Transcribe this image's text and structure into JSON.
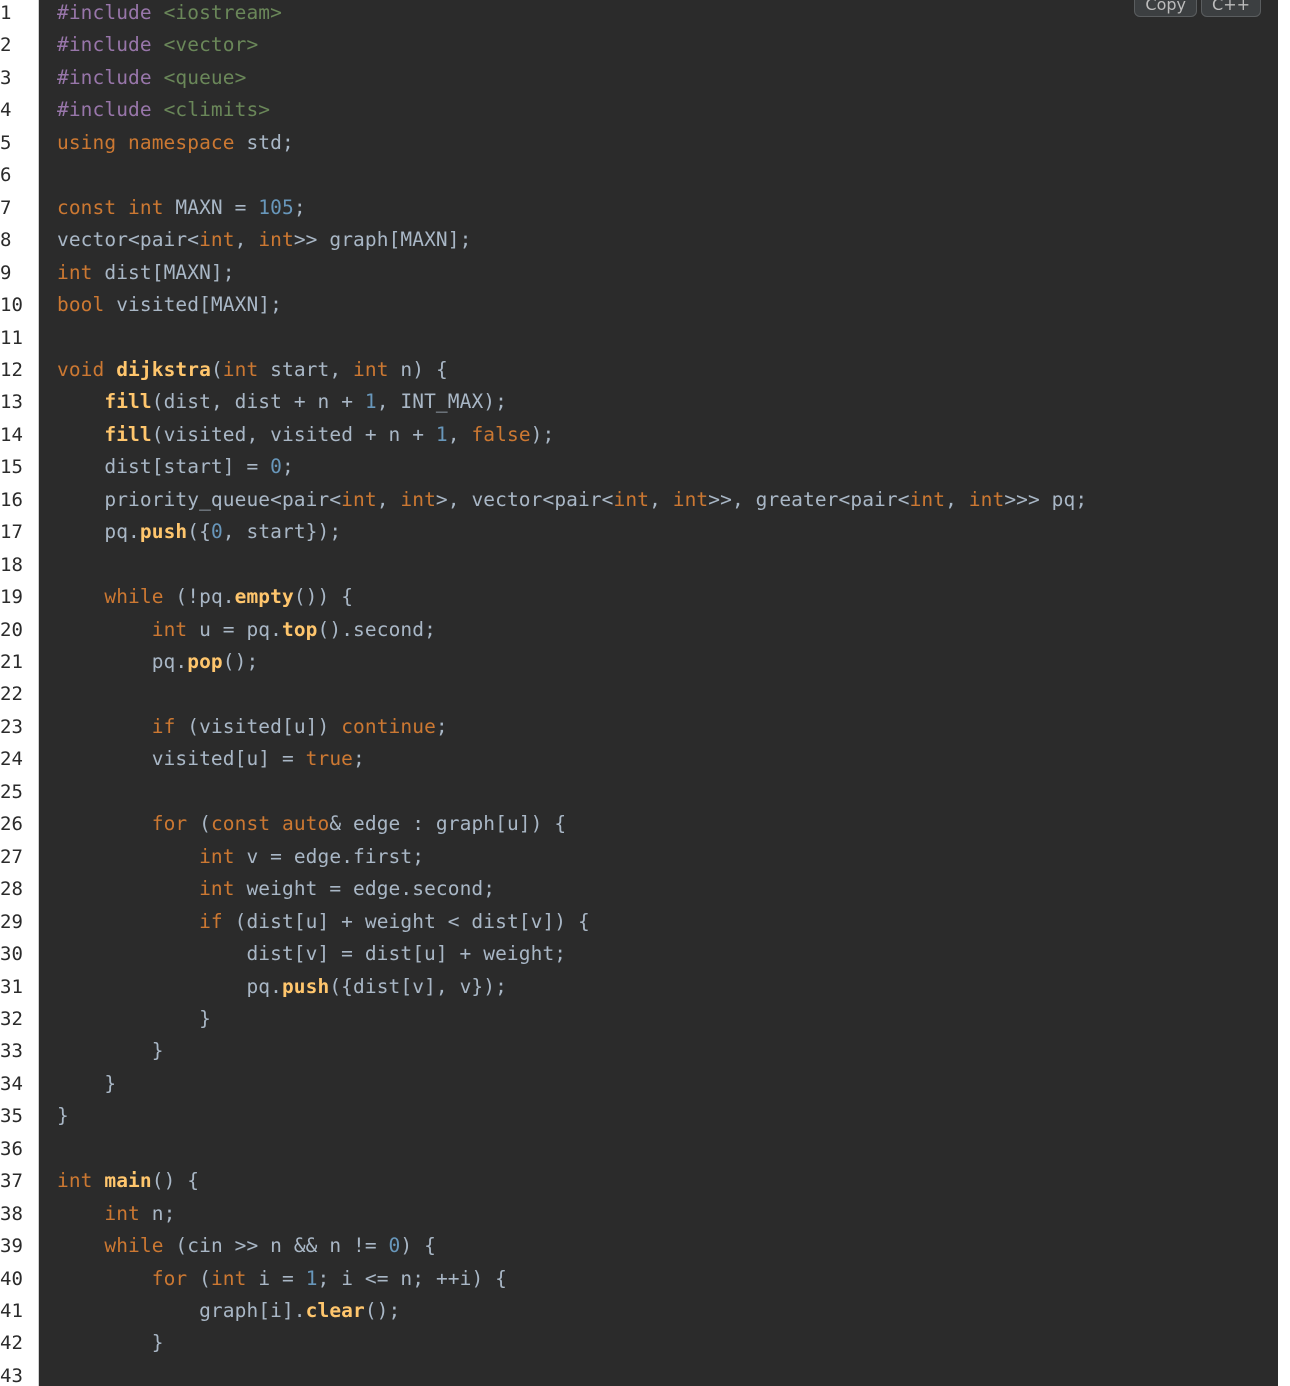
{
  "toolbar": {
    "copy_label": "Copy",
    "language_label": "C++"
  },
  "colors": {
    "background": "#2b2b2b",
    "text": "#a9b7c6",
    "keyword": "#cc7832",
    "preprocessor": "#9876aa",
    "include_path": "#6a8759",
    "number": "#6897bb",
    "function": "#ffc66d"
  },
  "lines": [
    {
      "n": "1",
      "t": [
        [
          "pre",
          "#include "
        ],
        [
          "str",
          "<iostream>"
        ]
      ]
    },
    {
      "n": "2",
      "t": [
        [
          "pre",
          "#include "
        ],
        [
          "str",
          "<vector>"
        ]
      ]
    },
    {
      "n": "3",
      "t": [
        [
          "pre",
          "#include "
        ],
        [
          "str",
          "<queue>"
        ]
      ]
    },
    {
      "n": "4",
      "t": [
        [
          "pre",
          "#include "
        ],
        [
          "str",
          "<climits>"
        ]
      ]
    },
    {
      "n": "5",
      "t": [
        [
          "kw",
          "using namespace "
        ],
        [
          "txt",
          "std;"
        ]
      ]
    },
    {
      "n": "6",
      "t": []
    },
    {
      "n": "7",
      "t": [
        [
          "kw",
          "const int "
        ],
        [
          "txt",
          "MAXN = "
        ],
        [
          "num",
          "105"
        ],
        [
          "txt",
          ";"
        ]
      ]
    },
    {
      "n": "8",
      "t": [
        [
          "txt",
          "vector<pair<"
        ],
        [
          "kw",
          "int"
        ],
        [
          "txt",
          ", "
        ],
        [
          "kw",
          "int"
        ],
        [
          "txt",
          ">> graph[MAXN];"
        ]
      ]
    },
    {
      "n": "9",
      "t": [
        [
          "kw",
          "int "
        ],
        [
          "txt",
          "dist[MAXN];"
        ]
      ]
    },
    {
      "n": "10",
      "t": [
        [
          "kw",
          "bool "
        ],
        [
          "txt",
          "visited[MAXN];"
        ]
      ]
    },
    {
      "n": "11",
      "t": []
    },
    {
      "n": "12",
      "t": [
        [
          "kw",
          "void "
        ],
        [
          "fn",
          "dijkstra"
        ],
        [
          "txt",
          "("
        ],
        [
          "kw",
          "int "
        ],
        [
          "txt",
          "start, "
        ],
        [
          "kw",
          "int "
        ],
        [
          "txt",
          "n) {"
        ]
      ]
    },
    {
      "n": "13",
      "t": [
        [
          "txt",
          "    "
        ],
        [
          "fn",
          "fill"
        ],
        [
          "txt",
          "(dist, dist + n + "
        ],
        [
          "num",
          "1"
        ],
        [
          "txt",
          ", INT_MAX);"
        ]
      ]
    },
    {
      "n": "14",
      "t": [
        [
          "txt",
          "    "
        ],
        [
          "fn",
          "fill"
        ],
        [
          "txt",
          "(visited, visited + n + "
        ],
        [
          "num",
          "1"
        ],
        [
          "txt",
          ", "
        ],
        [
          "kw",
          "false"
        ],
        [
          "txt",
          ");"
        ]
      ]
    },
    {
      "n": "15",
      "t": [
        [
          "txt",
          "    dist[start] = "
        ],
        [
          "num",
          "0"
        ],
        [
          "txt",
          ";"
        ]
      ]
    },
    {
      "n": "16",
      "t": [
        [
          "txt",
          "    priority_queue<pair<"
        ],
        [
          "kw",
          "int"
        ],
        [
          "txt",
          ", "
        ],
        [
          "kw",
          "int"
        ],
        [
          "txt",
          ">, vector<pair<"
        ],
        [
          "kw",
          "int"
        ],
        [
          "txt",
          ", "
        ],
        [
          "kw",
          "int"
        ],
        [
          "txt",
          ">>, greater<pair<"
        ],
        [
          "kw",
          "int"
        ],
        [
          "txt",
          ", "
        ],
        [
          "kw",
          "int"
        ],
        [
          "txt",
          ">>> pq;"
        ]
      ]
    },
    {
      "n": "17",
      "t": [
        [
          "txt",
          "    pq."
        ],
        [
          "fn",
          "push"
        ],
        [
          "txt",
          "({"
        ],
        [
          "num",
          "0"
        ],
        [
          "txt",
          ", start});"
        ]
      ]
    },
    {
      "n": "18",
      "t": []
    },
    {
      "n": "19",
      "t": [
        [
          "txt",
          "    "
        ],
        [
          "kw",
          "while "
        ],
        [
          "txt",
          "(!pq."
        ],
        [
          "fn",
          "empty"
        ],
        [
          "txt",
          "()) {"
        ]
      ]
    },
    {
      "n": "20",
      "t": [
        [
          "txt",
          "        "
        ],
        [
          "kw",
          "int "
        ],
        [
          "txt",
          "u = pq."
        ],
        [
          "fn",
          "top"
        ],
        [
          "txt",
          "().second;"
        ]
      ]
    },
    {
      "n": "21",
      "t": [
        [
          "txt",
          "        pq."
        ],
        [
          "fn",
          "pop"
        ],
        [
          "txt",
          "();"
        ]
      ]
    },
    {
      "n": "22",
      "t": []
    },
    {
      "n": "23",
      "t": [
        [
          "txt",
          "        "
        ],
        [
          "kw",
          "if "
        ],
        [
          "txt",
          "(visited[u]) "
        ],
        [
          "kw",
          "continue"
        ],
        [
          "txt",
          ";"
        ]
      ]
    },
    {
      "n": "24",
      "t": [
        [
          "txt",
          "        visited[u] = "
        ],
        [
          "kw",
          "true"
        ],
        [
          "txt",
          ";"
        ]
      ]
    },
    {
      "n": "25",
      "t": []
    },
    {
      "n": "26",
      "t": [
        [
          "txt",
          "        "
        ],
        [
          "kw",
          "for "
        ],
        [
          "txt",
          "("
        ],
        [
          "kw",
          "const auto"
        ],
        [
          "txt",
          "& edge : graph[u]) {"
        ]
      ]
    },
    {
      "n": "27",
      "t": [
        [
          "txt",
          "            "
        ],
        [
          "kw",
          "int "
        ],
        [
          "txt",
          "v = edge.first;"
        ]
      ]
    },
    {
      "n": "28",
      "t": [
        [
          "txt",
          "            "
        ],
        [
          "kw",
          "int "
        ],
        [
          "txt",
          "weight = edge.second;"
        ]
      ]
    },
    {
      "n": "29",
      "t": [
        [
          "txt",
          "            "
        ],
        [
          "kw",
          "if "
        ],
        [
          "txt",
          "(dist[u] + weight < dist[v]) {"
        ]
      ]
    },
    {
      "n": "30",
      "t": [
        [
          "txt",
          "                dist[v] = dist[u] + weight;"
        ]
      ]
    },
    {
      "n": "31",
      "t": [
        [
          "txt",
          "                pq."
        ],
        [
          "fn",
          "push"
        ],
        [
          "txt",
          "({dist[v], v});"
        ]
      ]
    },
    {
      "n": "32",
      "t": [
        [
          "txt",
          "            }"
        ]
      ]
    },
    {
      "n": "33",
      "t": [
        [
          "txt",
          "        }"
        ]
      ]
    },
    {
      "n": "34",
      "t": [
        [
          "txt",
          "    }"
        ]
      ]
    },
    {
      "n": "35",
      "t": [
        [
          "txt",
          "}"
        ]
      ]
    },
    {
      "n": "36",
      "t": []
    },
    {
      "n": "37",
      "t": [
        [
          "kw",
          "int "
        ],
        [
          "fn",
          "main"
        ],
        [
          "txt",
          "() {"
        ]
      ]
    },
    {
      "n": "38",
      "t": [
        [
          "txt",
          "    "
        ],
        [
          "kw",
          "int "
        ],
        [
          "txt",
          "n;"
        ]
      ]
    },
    {
      "n": "39",
      "t": [
        [
          "txt",
          "    "
        ],
        [
          "kw",
          "while "
        ],
        [
          "txt",
          "(cin >> n && n != "
        ],
        [
          "num",
          "0"
        ],
        [
          "txt",
          ") {"
        ]
      ]
    },
    {
      "n": "40",
      "t": [
        [
          "txt",
          "        "
        ],
        [
          "kw",
          "for "
        ],
        [
          "txt",
          "("
        ],
        [
          "kw",
          "int "
        ],
        [
          "txt",
          "i = "
        ],
        [
          "num",
          "1"
        ],
        [
          "txt",
          "; i <= n; ++i) {"
        ]
      ]
    },
    {
      "n": "41",
      "t": [
        [
          "txt",
          "            graph[i]."
        ],
        [
          "fn",
          "clear"
        ],
        [
          "txt",
          "();"
        ]
      ]
    },
    {
      "n": "42",
      "t": [
        [
          "txt",
          "        }"
        ]
      ]
    },
    {
      "n": "43",
      "t": []
    }
  ]
}
